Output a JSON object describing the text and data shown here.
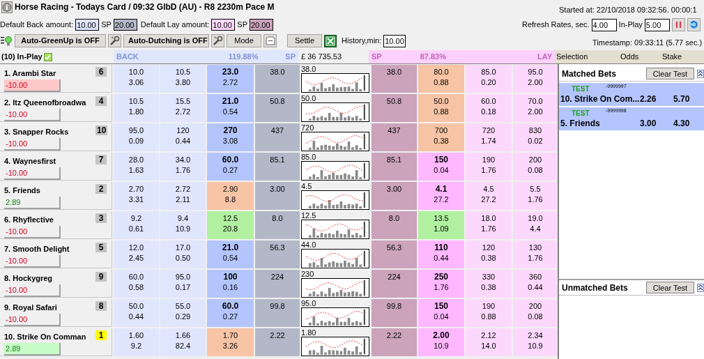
{
  "window": {
    "title": "Horse Racing - Todays Card / 09:32 GlbD (AU) - R8 2230m Pace M"
  },
  "started": "Started at: 22/10/2018 09:32:56. 00:00:1",
  "defaults": {
    "back_label": "Default Back amount:",
    "back_amount": "10.00",
    "back_sp_label": "SP",
    "back_sp": "20.00",
    "lay_label": "Default Lay amount:",
    "lay_amount": "10.00",
    "lay_sp_label": "SP",
    "lay_sp": "20.00"
  },
  "refresh": {
    "label": "Refresh Rates, sec.",
    "value": "4.00",
    "inplay_label": "In-Play",
    "inplay_value": "5.00"
  },
  "toolbar": {
    "greenup": "Auto-GreenUp is OFF",
    "dutching": "Auto-Dutching is OFF",
    "mode": "Mode",
    "settle": "Settle",
    "history_label": "History,min:",
    "history_value": "10.00"
  },
  "timestamp": "Timestamp: 09:33:11 (5.77 sec.)",
  "market": {
    "in_play_label": "(10) In-Play",
    "in_play_checked": true,
    "back_header": "BACK",
    "back_percent": "119.88%",
    "back_sp_header": "SP",
    "balance": "£ 36 735.53",
    "lay_sp_header": "SP",
    "lay_percent": "87.83%",
    "lay_header": "LAY"
  },
  "runners": [
    {
      "name": "1. Arambi Star",
      "cloth": {
        "text": "6",
        "color": "#c4c4c4"
      },
      "pl": {
        "text": "-10.00",
        "kind": "loss",
        "color": "#ffc8c8"
      },
      "back": [
        {
          "odds": "10.0",
          "amount": "3.06"
        },
        {
          "odds": "10.5",
          "amount": "3.80"
        }
      ],
      "best_back": {
        "odds": "23.0",
        "amount": "2.72"
      },
      "back_sp": "38.0",
      "chart_label": "38.0",
      "lay_sp": "38.0",
      "best_lay": {
        "odds": "80.0",
        "amount": "0.88",
        "color": "#f7c4a5"
      },
      "lay": [
        {
          "odds": "85.0",
          "amount": "0.20"
        },
        {
          "odds": "95.0",
          "amount": "2.00"
        }
      ]
    },
    {
      "name": "2. Itz Queenofbroadwa",
      "cloth": {
        "text": "4",
        "color": "#c4c4c4"
      },
      "pl": {
        "text": "-10.00",
        "kind": "loss",
        "color": "#f0f0f0"
      },
      "back": [
        {
          "odds": "10.5",
          "amount": "1.80"
        },
        {
          "odds": "15.5",
          "amount": "2.72"
        }
      ],
      "best_back": {
        "odds": "21.0",
        "amount": "0.54"
      },
      "back_sp": "50.8",
      "chart_label": "50.0",
      "lay_sp": "50.8",
      "best_lay": {
        "odds": "50.0",
        "amount": "0.88",
        "color": "#f7c4a5"
      },
      "lay": [
        {
          "odds": "60.0",
          "amount": "0.18"
        },
        {
          "odds": "70.0",
          "amount": "2.00"
        }
      ]
    },
    {
      "name": "3. Snapper Rocks",
      "cloth": {
        "text": "10",
        "color": "#c4c4c4"
      },
      "pl": {
        "text": "-10.00",
        "kind": "loss",
        "color": "#f0f0f0"
      },
      "back": [
        {
          "odds": "95.0",
          "amount": "0.09"
        },
        {
          "odds": "120",
          "amount": "0.44"
        }
      ],
      "best_back": {
        "odds": "270",
        "amount": "3.08"
      },
      "back_sp": "437",
      "chart_label": "720",
      "lay_sp": "437",
      "best_lay": {
        "odds": "700",
        "amount": "0.38",
        "color": "#f7c4a5"
      },
      "lay": [
        {
          "odds": "720",
          "amount": "1.74"
        },
        {
          "odds": "830",
          "amount": "0.02"
        }
      ]
    },
    {
      "name": "4. Waynesfirst",
      "cloth": {
        "text": "7",
        "color": "#c4c4c4"
      },
      "pl": {
        "text": "-10.00",
        "kind": "loss",
        "color": "#f0f0f0"
      },
      "back": [
        {
          "odds": "28.0",
          "amount": "1.63"
        },
        {
          "odds": "34.0",
          "amount": "1.76"
        }
      ],
      "best_back": {
        "odds": "60.0",
        "amount": "0.27"
      },
      "back_sp": "85.1",
      "chart_label": "85.0",
      "lay_sp": "85.1",
      "best_lay": {
        "odds": "150",
        "amount": "0.04"
      },
      "lay": [
        {
          "odds": "190",
          "amount": "1.76"
        },
        {
          "odds": "200",
          "amount": "0.08"
        }
      ]
    },
    {
      "name": "5. Friends",
      "cloth": {
        "text": "2",
        "color": "#c4c4c4"
      },
      "pl": {
        "text": "2.89",
        "kind": "profit",
        "color": "#f0f0f0"
      },
      "back": [
        {
          "odds": "2.70",
          "amount": "3.31"
        },
        {
          "odds": "2.72",
          "amount": "2.11"
        }
      ],
      "best_back": {
        "odds": "2.90",
        "amount": "8.8",
        "color": "#f7c4a5"
      },
      "back_sp": "3.00",
      "chart_label": "4.5",
      "lay_sp": "3.00",
      "best_lay": {
        "odds": "4.1",
        "amount": "27.2"
      },
      "lay": [
        {
          "odds": "4.5",
          "amount": "27.2"
        },
        {
          "odds": "5.5",
          "amount": "1.76"
        }
      ]
    },
    {
      "name": "6. Rhyflective",
      "cloth": {
        "text": "3",
        "color": "#c4c4c4"
      },
      "pl": {
        "text": "-10.00",
        "kind": "loss",
        "color": "#f0f0f0"
      },
      "back": [
        {
          "odds": "9.2",
          "amount": "0.61"
        },
        {
          "odds": "9.4",
          "amount": "10.9"
        }
      ],
      "best_back": {
        "odds": "12.5",
        "amount": "20.8",
        "color": "#b0f0a0"
      },
      "back_sp": "8.0",
      "chart_label": "12.5",
      "lay_sp": "8.0",
      "best_lay": {
        "odds": "13.5",
        "amount": "1.09",
        "color": "#b0f0a0"
      },
      "lay": [
        {
          "odds": "18.0",
          "amount": "1.76"
        },
        {
          "odds": "19.0",
          "amount": "4.4"
        }
      ]
    },
    {
      "name": "7. Smooth Delight",
      "cloth": {
        "text": "5",
        "color": "#c4c4c4"
      },
      "pl": {
        "text": "-10.00",
        "kind": "loss",
        "color": "#f0f0f0"
      },
      "back": [
        {
          "odds": "12.0",
          "amount": "2.45"
        },
        {
          "odds": "17.0",
          "amount": "0.50"
        }
      ],
      "best_back": {
        "odds": "21.0",
        "amount": "0.54"
      },
      "back_sp": "56.3",
      "chart_label": "44.0",
      "lay_sp": "56.3",
      "best_lay": {
        "odds": "110",
        "amount": "0.44"
      },
      "lay": [
        {
          "odds": "120",
          "amount": "0.38"
        },
        {
          "odds": "130",
          "amount": "1.76"
        }
      ]
    },
    {
      "name": "8. Hockygreg",
      "cloth": {
        "text": "9",
        "color": "#c4c4c4"
      },
      "pl": {
        "text": "-10.00",
        "kind": "loss",
        "color": "#f0f0f0"
      },
      "back": [
        {
          "odds": "60.0",
          "amount": "0.58"
        },
        {
          "odds": "95.0",
          "amount": "0.17"
        }
      ],
      "best_back": {
        "odds": "100",
        "amount": "0.16"
      },
      "back_sp": "224",
      "chart_label": "230",
      "lay_sp": "224",
      "best_lay": {
        "odds": "250",
        "amount": "1.76"
      },
      "lay": [
        {
          "odds": "330",
          "amount": "0.38"
        },
        {
          "odds": "360",
          "amount": "0.44"
        }
      ]
    },
    {
      "name": "9. Royal Safari",
      "cloth": {
        "text": "8",
        "color": "#c4c4c4"
      },
      "pl": {
        "text": "-10.00",
        "kind": "loss",
        "color": "#f0f0f0"
      },
      "back": [
        {
          "odds": "50.0",
          "amount": "0.44"
        },
        {
          "odds": "55.0",
          "amount": "0.29"
        }
      ],
      "best_back": {
        "odds": "60.0",
        "amount": "0.27"
      },
      "back_sp": "99.8",
      "chart_label": "95.0",
      "lay_sp": "99.8",
      "best_lay": {
        "odds": "150",
        "amount": "0.04"
      },
      "lay": [
        {
          "odds": "190",
          "amount": "0.88"
        },
        {
          "odds": "200",
          "amount": "0.08"
        }
      ]
    },
    {
      "name": "10. Strike On Comman",
      "cloth": {
        "text": "1",
        "color": "#ffff00"
      },
      "pl": {
        "text": "2.89",
        "kind": "profit",
        "color": "#c8fcc8"
      },
      "back": [
        {
          "odds": "1.60",
          "amount": "9.2"
        },
        {
          "odds": "1.66",
          "amount": "82.4"
        }
      ],
      "best_back": {
        "odds": "1.70",
        "amount": "3.26",
        "color": "#f7c4a5"
      },
      "back_sp": "2.22",
      "chart_label": "1.80",
      "lay_sp": "2.22",
      "best_lay": {
        "odds": "2.00",
        "amount": "10.9"
      },
      "lay": [
        {
          "odds": "2.12",
          "amount": "14.0"
        },
        {
          "odds": "2.34",
          "amount": "10.9"
        }
      ]
    }
  ],
  "bets_panel": {
    "columns": [
      "Selection",
      "Odds",
      "Stake"
    ],
    "matched": {
      "title": "Matched Bets",
      "button": "Clear Test",
      "bets": [
        {
          "tag": "TEST",
          "ref": "-9999997",
          "selection": "10. Strike On Com...",
          "odds": "2.26",
          "stake": "5.70"
        },
        {
          "tag": "TEST",
          "ref": "-9999998",
          "selection": "5. Friends",
          "odds": "3.00",
          "stake": "4.30"
        }
      ]
    },
    "unmatched": {
      "title": "Unmatched Bets",
      "button": "Clear Test"
    }
  }
}
